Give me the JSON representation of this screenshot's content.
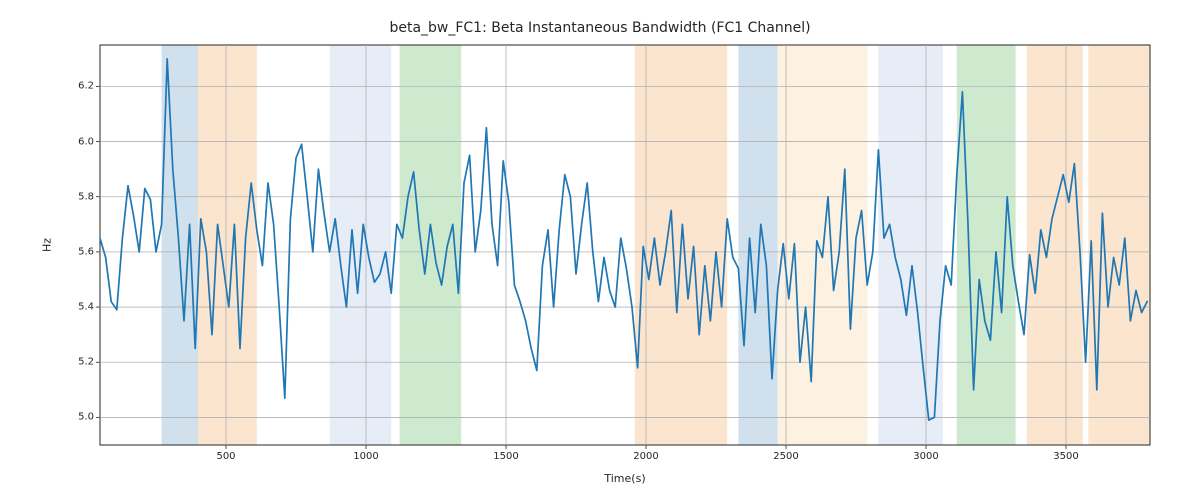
{
  "chart_data": {
    "type": "line",
    "title": "beta_bw_FC1: Beta Instantaneous Bandwidth (FC1 Channel)",
    "xlabel": "Time(s)",
    "ylabel": "Hz",
    "xlim": [
      50,
      3800
    ],
    "ylim": [
      4.9,
      6.35
    ],
    "x_ticks": [
      500,
      1000,
      1500,
      2000,
      2500,
      3000,
      3500
    ],
    "y_ticks": [
      5.0,
      5.2,
      5.4,
      5.6,
      5.8,
      6.0,
      6.2
    ],
    "grid": true,
    "line_color": "#1f77b4",
    "spans": [
      {
        "x0": 270,
        "x1": 400,
        "color": "#a9c6dd",
        "alpha": 0.55
      },
      {
        "x0": 400,
        "x1": 610,
        "color": "#f8d0a5",
        "alpha": 0.55
      },
      {
        "x0": 870,
        "x1": 1090,
        "color": "#d2def0",
        "alpha": 0.55
      },
      {
        "x0": 1120,
        "x1": 1340,
        "color": "#a6d8a6",
        "alpha": 0.55
      },
      {
        "x0": 1960,
        "x1": 2290,
        "color": "#f8d0a5",
        "alpha": 0.55
      },
      {
        "x0": 2330,
        "x1": 2470,
        "color": "#a9c6dd",
        "alpha": 0.55
      },
      {
        "x0": 2470,
        "x1": 2790,
        "color": "#fbe6cb",
        "alpha": 0.55
      },
      {
        "x0": 2830,
        "x1": 3060,
        "color": "#d2def0",
        "alpha": 0.55
      },
      {
        "x0": 3110,
        "x1": 3320,
        "color": "#a6d8a6",
        "alpha": 0.55
      },
      {
        "x0": 3360,
        "x1": 3560,
        "color": "#f8d0a5",
        "alpha": 0.55
      },
      {
        "x0": 3580,
        "x1": 3800,
        "color": "#f8d0a5",
        "alpha": 0.55
      }
    ],
    "x": [
      50,
      70,
      90,
      110,
      130,
      150,
      170,
      190,
      210,
      230,
      250,
      270,
      290,
      310,
      330,
      350,
      370,
      390,
      410,
      430,
      450,
      470,
      490,
      510,
      530,
      550,
      570,
      590,
      610,
      630,
      650,
      670,
      690,
      710,
      730,
      750,
      770,
      790,
      810,
      830,
      850,
      870,
      890,
      910,
      930,
      950,
      970,
      990,
      1010,
      1030,
      1050,
      1070,
      1090,
      1110,
      1130,
      1150,
      1170,
      1190,
      1210,
      1230,
      1250,
      1270,
      1290,
      1310,
      1330,
      1350,
      1370,
      1390,
      1410,
      1430,
      1450,
      1470,
      1490,
      1510,
      1530,
      1550,
      1570,
      1590,
      1610,
      1630,
      1650,
      1670,
      1690,
      1710,
      1730,
      1750,
      1770,
      1790,
      1810,
      1830,
      1850,
      1870,
      1890,
      1910,
      1930,
      1950,
      1970,
      1990,
      2010,
      2030,
      2050,
      2070,
      2090,
      2110,
      2130,
      2150,
      2170,
      2190,
      2210,
      2230,
      2250,
      2270,
      2290,
      2310,
      2330,
      2350,
      2370,
      2390,
      2410,
      2430,
      2450,
      2470,
      2490,
      2510,
      2530,
      2550,
      2570,
      2590,
      2610,
      2630,
      2650,
      2670,
      2690,
      2710,
      2730,
      2750,
      2770,
      2790,
      2810,
      2830,
      2850,
      2870,
      2890,
      2910,
      2930,
      2950,
      2970,
      2990,
      3010,
      3030,
      3050,
      3070,
      3090,
      3110,
      3130,
      3150,
      3170,
      3190,
      3210,
      3230,
      3250,
      3270,
      3290,
      3310,
      3330,
      3350,
      3370,
      3390,
      3410,
      3430,
      3450,
      3470,
      3490,
      3510,
      3530,
      3550,
      3570,
      3590,
      3610,
      3630,
      3650,
      3670,
      3690,
      3710,
      3730,
      3750,
      3770,
      3790
    ],
    "values": [
      5.65,
      5.58,
      5.42,
      5.39,
      5.65,
      5.84,
      5.73,
      5.6,
      5.83,
      5.79,
      5.6,
      5.7,
      6.3,
      5.9,
      5.65,
      5.35,
      5.7,
      5.25,
      5.72,
      5.6,
      5.3,
      5.7,
      5.55,
      5.4,
      5.7,
      5.25,
      5.65,
      5.85,
      5.68,
      5.55,
      5.85,
      5.7,
      5.4,
      5.07,
      5.72,
      5.94,
      5.99,
      5.8,
      5.6,
      5.9,
      5.74,
      5.6,
      5.72,
      5.55,
      5.4,
      5.68,
      5.45,
      5.7,
      5.58,
      5.49,
      5.52,
      5.6,
      5.45,
      5.7,
      5.65,
      5.8,
      5.89,
      5.68,
      5.52,
      5.7,
      5.56,
      5.48,
      5.62,
      5.7,
      5.45,
      5.85,
      5.95,
      5.6,
      5.75,
      6.05,
      5.7,
      5.55,
      5.93,
      5.78,
      5.48,
      5.42,
      5.35,
      5.25,
      5.17,
      5.55,
      5.68,
      5.4,
      5.68,
      5.88,
      5.8,
      5.52,
      5.7,
      5.85,
      5.6,
      5.42,
      5.58,
      5.46,
      5.4,
      5.65,
      5.54,
      5.4,
      5.18,
      5.62,
      5.5,
      5.65,
      5.48,
      5.6,
      5.75,
      5.38,
      5.7,
      5.43,
      5.62,
      5.3,
      5.55,
      5.35,
      5.6,
      5.4,
      5.72,
      5.58,
      5.54,
      5.26,
      5.65,
      5.38,
      5.7,
      5.55,
      5.14,
      5.46,
      5.63,
      5.43,
      5.63,
      5.2,
      5.4,
      5.13,
      5.64,
      5.58,
      5.8,
      5.46,
      5.6,
      5.9,
      5.32,
      5.65,
      5.75,
      5.48,
      5.6,
      5.97,
      5.65,
      5.7,
      5.58,
      5.5,
      5.37,
      5.55,
      5.38,
      5.18,
      4.99,
      5.0,
      5.35,
      5.55,
      5.48,
      5.88,
      6.18,
      5.7,
      5.1,
      5.5,
      5.35,
      5.28,
      5.6,
      5.38,
      5.8,
      5.55,
      5.42,
      5.3,
      5.59,
      5.45,
      5.68,
      5.58,
      5.72,
      5.8,
      5.88,
      5.78,
      5.92,
      5.6,
      5.2,
      5.64,
      5.1,
      5.74,
      5.4,
      5.58,
      5.48,
      5.65,
      5.35,
      5.46,
      5.38,
      5.42
    ]
  }
}
